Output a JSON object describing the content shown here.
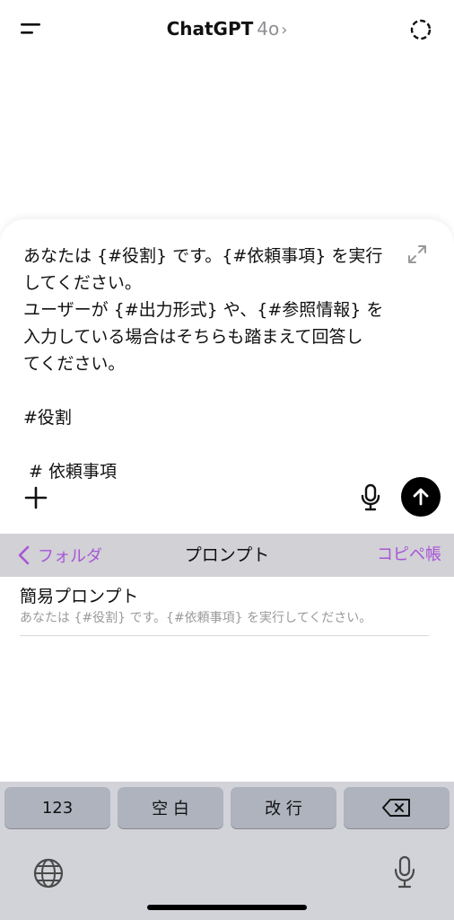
{
  "header": {
    "title": "ChatGPT",
    "model": "4o",
    "chevron": "›",
    "left_icon": "menu-icon",
    "right_icon": "temporary-chat-icon"
  },
  "composer": {
    "lines": [
      "あなたは {#役割} です。{#依頼事項} を実行",
      "してください。",
      "ユーザーが {#出力形式} や、{#参照情報} を",
      "入力している場合はそちらも踏まえて回答し",
      "てください。",
      "",
      "#役割",
      "",
      " # 依頼事項"
    ],
    "expand_icon": "expand-icon",
    "plus_icon": "plus-icon",
    "mic_icon": "microphone-icon",
    "send_icon": "arrow-up-icon"
  },
  "accessory_bar": {
    "back_label": "フォルダ",
    "title": "プロンプト",
    "right_label": "コピペ帳",
    "accent_color": "#a855d6"
  },
  "prompt_list": [
    {
      "title": "簡易プロンプト",
      "preview": "あなたは {#役割} です。{#依頼事項} を実行してください。"
    }
  ],
  "keyboard": {
    "keys": [
      "123",
      "空 白",
      "改 行"
    ],
    "delete_icon": "delete-icon",
    "globe_icon": "globe-icon",
    "dictation_icon": "microphone-icon"
  }
}
